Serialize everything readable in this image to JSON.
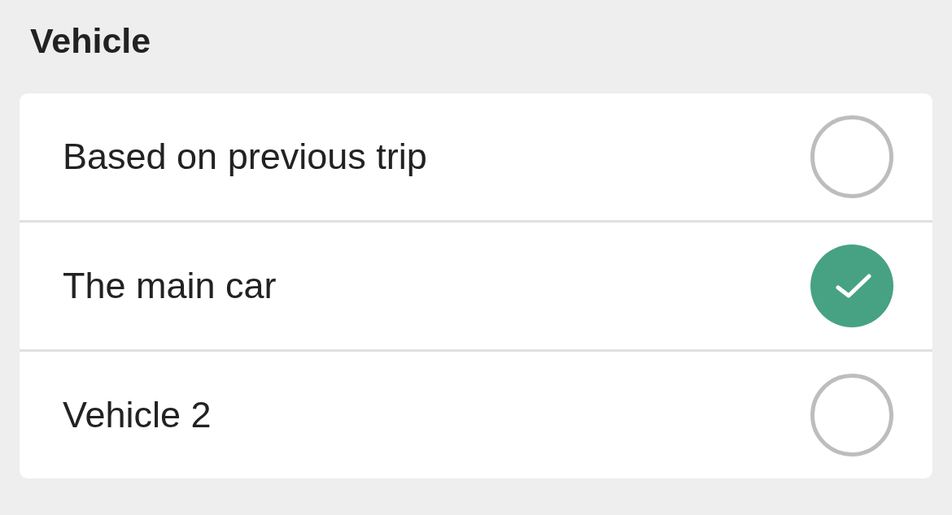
{
  "section": {
    "title": "Vehicle"
  },
  "options": [
    {
      "label": "Based on previous trip",
      "selected": false
    },
    {
      "label": "The main car",
      "selected": true
    },
    {
      "label": "Vehicle 2",
      "selected": false
    }
  ]
}
